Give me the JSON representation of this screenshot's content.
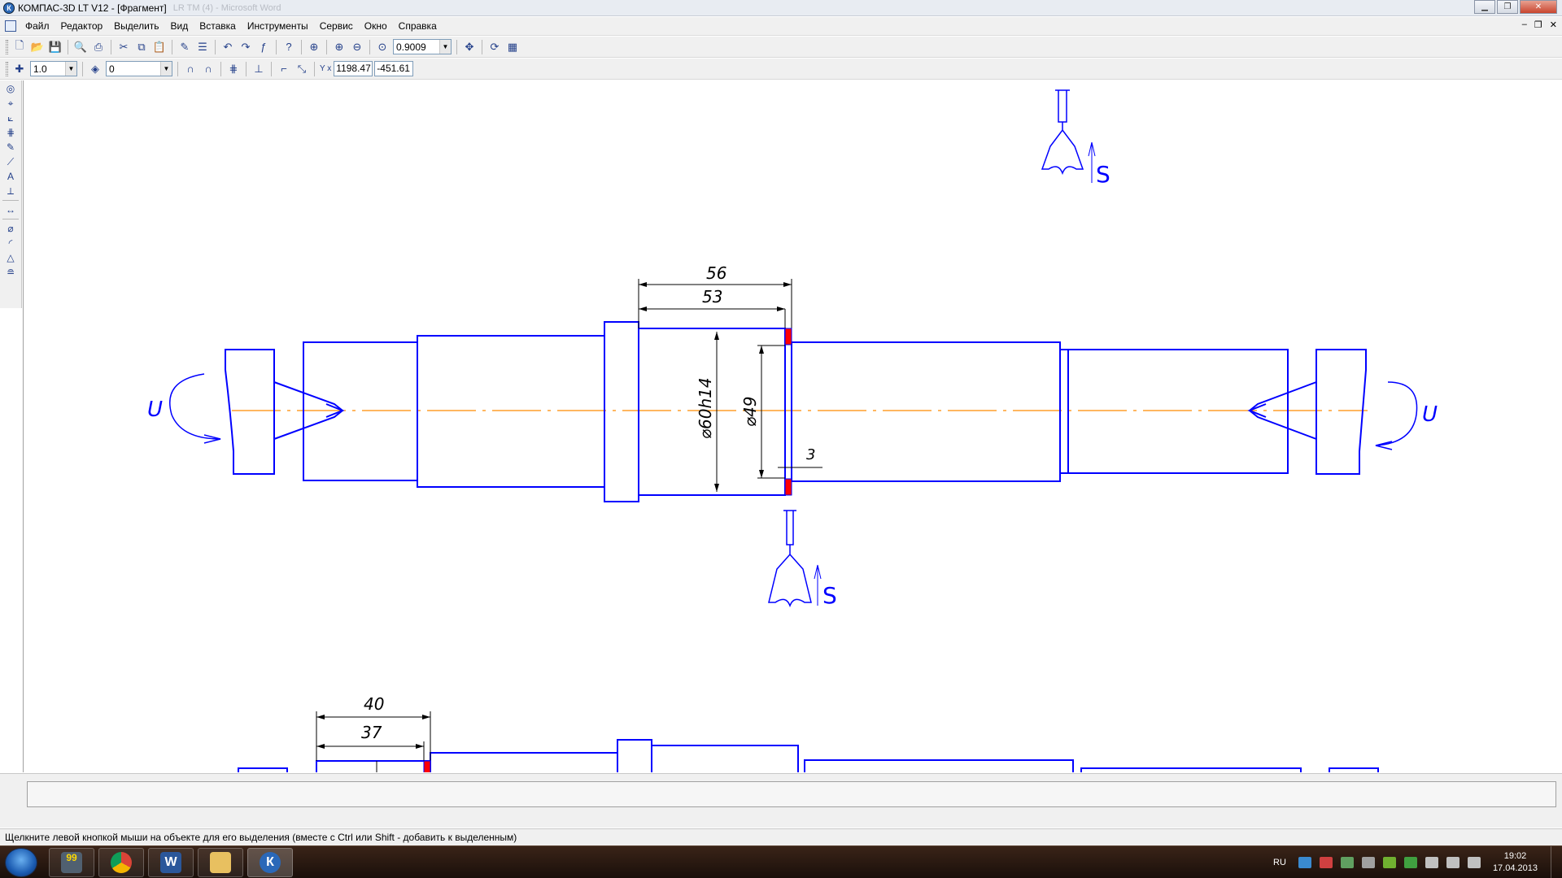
{
  "window": {
    "title": "КОМПАС-3D LT V12 - [Фрагмент]",
    "title_ghost": "LR TM (4) - Microsoft Word",
    "app_logo": "К"
  },
  "menu": [
    "Файл",
    "Редактор",
    "Выделить",
    "Вид",
    "Вставка",
    "Инструменты",
    "Сервис",
    "Окно",
    "Справка"
  ],
  "toolbar": {
    "zoom_value": "0.9009",
    "step_value": "1.0",
    "layer_value": "0",
    "coord_x": "1198.47",
    "coord_y": "-451.61",
    "coord_label": "Y x"
  },
  "drawing": {
    "dim_56": "56",
    "dim_53": "53",
    "dim_dia60": "⌀60h14",
    "dim_dia49": "⌀49",
    "dim_3": "3",
    "label_u_left": "U",
    "label_u_right": "U",
    "label_s_top": "S",
    "label_s_bottom": "S",
    "dim_40": "40",
    "dim_37": "37"
  },
  "statusbar": {
    "hint": "Щелкните левой кнопкой мыши на объекте для его выделения (вместе с Ctrl или Shift - добавить к выделенным)"
  },
  "taskbar": {
    "lang": "RU",
    "time": "19:02",
    "date": "17.04.2013",
    "badge": "99"
  },
  "colors": {
    "drawing_line": "#0000ff",
    "axis_line": "#ff8c00",
    "highlight": "#ff0000"
  }
}
